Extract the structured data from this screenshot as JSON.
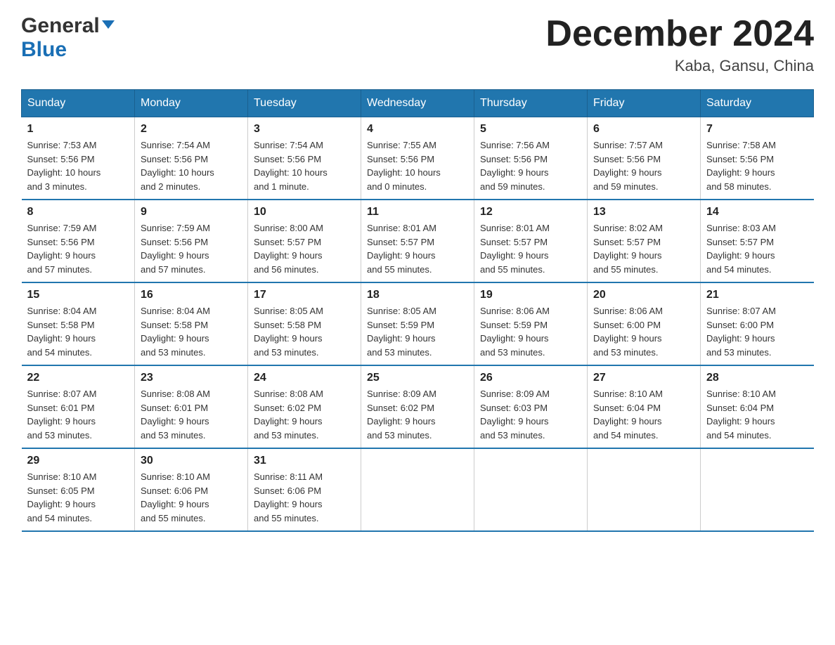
{
  "logo": {
    "general": "General",
    "blue": "Blue"
  },
  "title": "December 2024",
  "location": "Kaba, Gansu, China",
  "days_of_week": [
    "Sunday",
    "Monday",
    "Tuesday",
    "Wednesday",
    "Thursday",
    "Friday",
    "Saturday"
  ],
  "weeks": [
    [
      {
        "day": "1",
        "sunrise": "7:53 AM",
        "sunset": "5:56 PM",
        "daylight": "10 hours",
        "daylight2": "and 3 minutes."
      },
      {
        "day": "2",
        "sunrise": "7:54 AM",
        "sunset": "5:56 PM",
        "daylight": "10 hours",
        "daylight2": "and 2 minutes."
      },
      {
        "day": "3",
        "sunrise": "7:54 AM",
        "sunset": "5:56 PM",
        "daylight": "10 hours",
        "daylight2": "and 1 minute."
      },
      {
        "day": "4",
        "sunrise": "7:55 AM",
        "sunset": "5:56 PM",
        "daylight": "10 hours",
        "daylight2": "and 0 minutes."
      },
      {
        "day": "5",
        "sunrise": "7:56 AM",
        "sunset": "5:56 PM",
        "daylight": "9 hours",
        "daylight2": "and 59 minutes."
      },
      {
        "day": "6",
        "sunrise": "7:57 AM",
        "sunset": "5:56 PM",
        "daylight": "9 hours",
        "daylight2": "and 59 minutes."
      },
      {
        "day": "7",
        "sunrise": "7:58 AM",
        "sunset": "5:56 PM",
        "daylight": "9 hours",
        "daylight2": "and 58 minutes."
      }
    ],
    [
      {
        "day": "8",
        "sunrise": "7:59 AM",
        "sunset": "5:56 PM",
        "daylight": "9 hours",
        "daylight2": "and 57 minutes."
      },
      {
        "day": "9",
        "sunrise": "7:59 AM",
        "sunset": "5:56 PM",
        "daylight": "9 hours",
        "daylight2": "and 57 minutes."
      },
      {
        "day": "10",
        "sunrise": "8:00 AM",
        "sunset": "5:57 PM",
        "daylight": "9 hours",
        "daylight2": "and 56 minutes."
      },
      {
        "day": "11",
        "sunrise": "8:01 AM",
        "sunset": "5:57 PM",
        "daylight": "9 hours",
        "daylight2": "and 55 minutes."
      },
      {
        "day": "12",
        "sunrise": "8:01 AM",
        "sunset": "5:57 PM",
        "daylight": "9 hours",
        "daylight2": "and 55 minutes."
      },
      {
        "day": "13",
        "sunrise": "8:02 AM",
        "sunset": "5:57 PM",
        "daylight": "9 hours",
        "daylight2": "and 55 minutes."
      },
      {
        "day": "14",
        "sunrise": "8:03 AM",
        "sunset": "5:57 PM",
        "daylight": "9 hours",
        "daylight2": "and 54 minutes."
      }
    ],
    [
      {
        "day": "15",
        "sunrise": "8:04 AM",
        "sunset": "5:58 PM",
        "daylight": "9 hours",
        "daylight2": "and 54 minutes."
      },
      {
        "day": "16",
        "sunrise": "8:04 AM",
        "sunset": "5:58 PM",
        "daylight": "9 hours",
        "daylight2": "and 53 minutes."
      },
      {
        "day": "17",
        "sunrise": "8:05 AM",
        "sunset": "5:58 PM",
        "daylight": "9 hours",
        "daylight2": "and 53 minutes."
      },
      {
        "day": "18",
        "sunrise": "8:05 AM",
        "sunset": "5:59 PM",
        "daylight": "9 hours",
        "daylight2": "and 53 minutes."
      },
      {
        "day": "19",
        "sunrise": "8:06 AM",
        "sunset": "5:59 PM",
        "daylight": "9 hours",
        "daylight2": "and 53 minutes."
      },
      {
        "day": "20",
        "sunrise": "8:06 AM",
        "sunset": "6:00 PM",
        "daylight": "9 hours",
        "daylight2": "and 53 minutes."
      },
      {
        "day": "21",
        "sunrise": "8:07 AM",
        "sunset": "6:00 PM",
        "daylight": "9 hours",
        "daylight2": "and 53 minutes."
      }
    ],
    [
      {
        "day": "22",
        "sunrise": "8:07 AM",
        "sunset": "6:01 PM",
        "daylight": "9 hours",
        "daylight2": "and 53 minutes."
      },
      {
        "day": "23",
        "sunrise": "8:08 AM",
        "sunset": "6:01 PM",
        "daylight": "9 hours",
        "daylight2": "and 53 minutes."
      },
      {
        "day": "24",
        "sunrise": "8:08 AM",
        "sunset": "6:02 PM",
        "daylight": "9 hours",
        "daylight2": "and 53 minutes."
      },
      {
        "day": "25",
        "sunrise": "8:09 AM",
        "sunset": "6:02 PM",
        "daylight": "9 hours",
        "daylight2": "and 53 minutes."
      },
      {
        "day": "26",
        "sunrise": "8:09 AM",
        "sunset": "6:03 PM",
        "daylight": "9 hours",
        "daylight2": "and 53 minutes."
      },
      {
        "day": "27",
        "sunrise": "8:10 AM",
        "sunset": "6:04 PM",
        "daylight": "9 hours",
        "daylight2": "and 54 minutes."
      },
      {
        "day": "28",
        "sunrise": "8:10 AM",
        "sunset": "6:04 PM",
        "daylight": "9 hours",
        "daylight2": "and 54 minutes."
      }
    ],
    [
      {
        "day": "29",
        "sunrise": "8:10 AM",
        "sunset": "6:05 PM",
        "daylight": "9 hours",
        "daylight2": "and 54 minutes."
      },
      {
        "day": "30",
        "sunrise": "8:10 AM",
        "sunset": "6:06 PM",
        "daylight": "9 hours",
        "daylight2": "and 55 minutes."
      },
      {
        "day": "31",
        "sunrise": "8:11 AM",
        "sunset": "6:06 PM",
        "daylight": "9 hours",
        "daylight2": "and 55 minutes."
      },
      null,
      null,
      null,
      null
    ]
  ]
}
